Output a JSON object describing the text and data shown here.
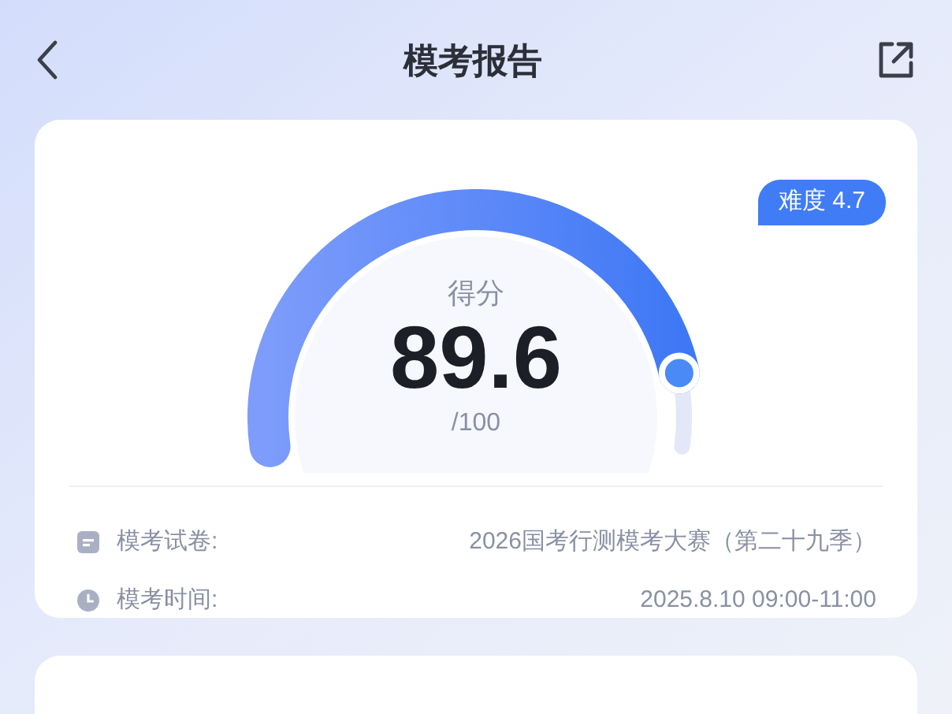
{
  "header": {
    "title": "模考报告"
  },
  "score_card": {
    "badge": "难度 4.7",
    "score_label": "得分",
    "score": "89.6",
    "total": "/100",
    "info": [
      {
        "kind": "paper",
        "label": "模考试卷:",
        "value": "2026国考行测模考大赛（第二十九季）"
      },
      {
        "kind": "time",
        "label": "模考时间:",
        "value": "2025.8.10 09:00-11:00"
      }
    ]
  }
}
